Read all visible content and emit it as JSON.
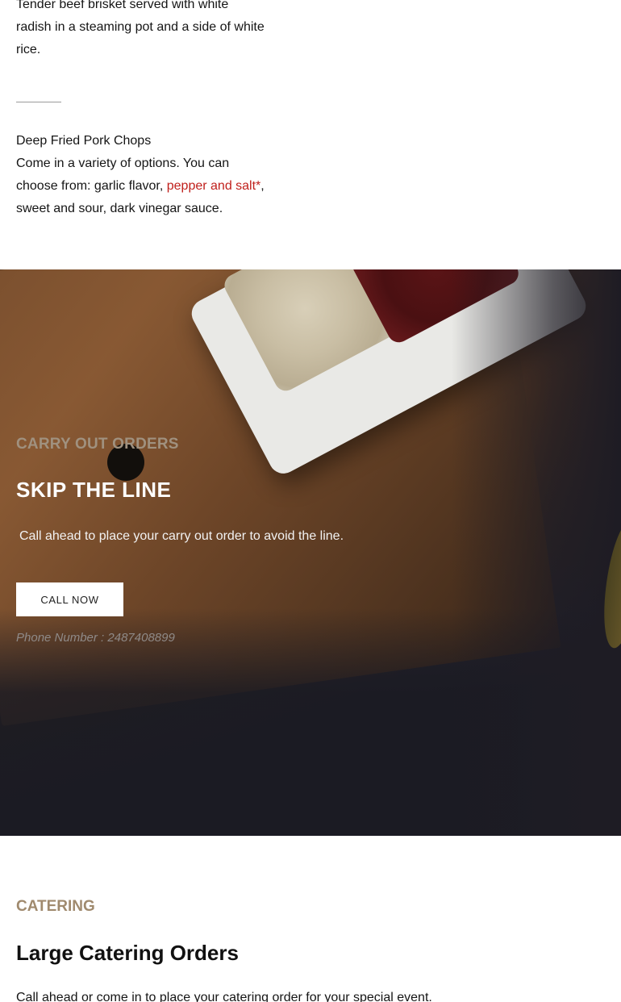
{
  "menu": {
    "dish1_description": "Tender beef brisket served with white radish in a steaming pot and a side of white rice.",
    "dish2_name": "Deep Fried Pork Chops",
    "dish2_description_start": "Come in a variety of options. You can choose from: garlic flavor, ",
    "dish2_highlight": "pepper and salt*",
    "dish2_description_end": ", sweet and sour, dark vinegar sauce."
  },
  "carry_out": {
    "eyebrow": "CARRY OUT ORDERS",
    "title": "SKIP THE LINE",
    "text": "Call ahead to place your carry out order to avoid the line.",
    "button_label": "CALL NOW",
    "phone": "Phone Number : 2487408899"
  },
  "catering": {
    "eyebrow": "CATERING",
    "title": "Large Catering Orders",
    "text": "Call ahead or come in to place your catering order for your special event."
  },
  "colors": {
    "accent_red": "#c0201c",
    "eyebrow_tan": "#a08a6e"
  }
}
